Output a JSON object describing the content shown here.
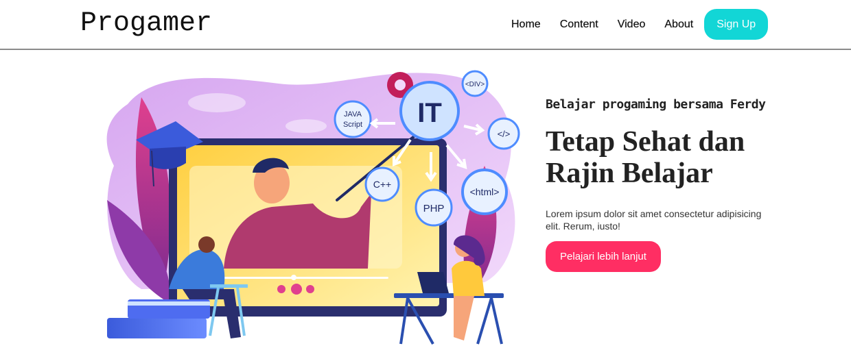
{
  "brand": {
    "logo_text": "Progamer"
  },
  "nav": {
    "items": [
      "Home",
      "Content",
      "Video",
      "About"
    ],
    "signup_label": "Sign Up",
    "signup_color": "#12d6d6"
  },
  "hero": {
    "subtitle": "Belajar progaming bersama Ferdy",
    "headline": "Tetap Sehat dan Rajin Belajar",
    "description": "Lorem ipsum dolor sit amet consectetur adipisicing elit. Rerum, iusto!",
    "cta_label": "Pelajari lebih lanjut",
    "cta_color": "#ff2e63"
  },
  "illustration": {
    "bubbles": [
      "IT",
      "JAVA",
      "Script",
      "<DIV>",
      "</>",
      "C++",
      "PHP",
      "<html>"
    ]
  }
}
